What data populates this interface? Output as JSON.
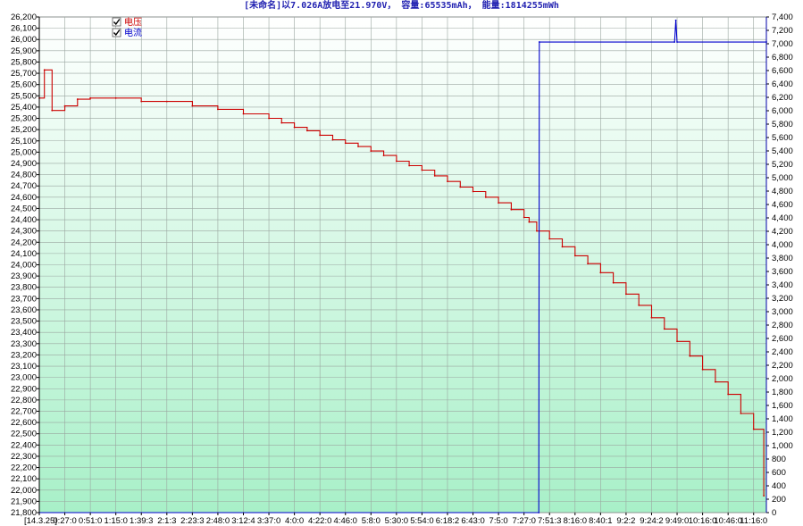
{
  "chart_data": {
    "type": "line",
    "title": "[未命名]以7.026A放电至21.970V， 容量:65535mAh， 能量:1814255mWh",
    "legend": [
      {
        "label": "电压",
        "checked": true,
        "color": "#cc0000"
      },
      {
        "label": "电流",
        "checked": true,
        "color": "#0000cc"
      }
    ],
    "legend_position": "top-left",
    "grid": true,
    "background_gradient": [
      "#ffffff",
      "#a8f0c8"
    ],
    "x_tick_labels": [
      "[14.3.25]",
      "0:27:0",
      "0:51:0",
      "1:15:0",
      "1:39:3",
      "2:1:3",
      "2:23:3",
      "2:48:0",
      "3:12:4",
      "3:37:0",
      "4:0:0",
      "4:22:0",
      "4:46:0",
      "5:8:0",
      "5:30:0",
      "5:54:0",
      "6:18:2",
      "6:43:0",
      "7:5:0",
      "7:27:0",
      "7:51:3",
      "8:16:0",
      "8:40:1",
      "9:2:2",
      "9:24:2",
      "9:49:0",
      "10:16:0",
      "10:46:0",
      "11:16:0"
    ],
    "y_left": {
      "ylim": [
        21800,
        26200
      ],
      "ticks": [
        "21,800",
        "21,900",
        "22,000",
        "22,100",
        "22,200",
        "22,300",
        "22,400",
        "22,500",
        "22,600",
        "22,700",
        "22,800",
        "22,900",
        "23,000",
        "23,100",
        "23,200",
        "23,300",
        "23,400",
        "23,500",
        "23,600",
        "23,700",
        "23,800",
        "23,900",
        "24,000",
        "24,100",
        "24,200",
        "24,300",
        "24,400",
        "24,500",
        "24,600",
        "24,700",
        "24,800",
        "24,900",
        "25,000",
        "25,100",
        "25,200",
        "25,300",
        "25,400",
        "25,500",
        "25,600",
        "25,700",
        "25,800",
        "25,900",
        "26,000",
        "26,100",
        "26,200"
      ]
    },
    "y_right": {
      "ylim": [
        0,
        7400
      ],
      "ticks": [
        "0",
        "200",
        "400",
        "600",
        "800",
        "1,000",
        "1,200",
        "1,400",
        "1,600",
        "1,800",
        "2,000",
        "2,200",
        "2,400",
        "2,600",
        "2,800",
        "3,000",
        "3,200",
        "3,400",
        "3,600",
        "3,800",
        "4,000",
        "4,200",
        "4,400",
        "4,600",
        "4,800",
        "5,000",
        "5,200",
        "5,400",
        "5,600",
        "5,800",
        "6,000",
        "6,200",
        "6,400",
        "6,600",
        "6,800",
        "7,000",
        "7,200",
        "7,400"
      ]
    },
    "series": [
      {
        "name": "电压",
        "axis": "left",
        "color": "#cc0000",
        "x": [
          0,
          0.2,
          0.5,
          1,
          1.5,
          2,
          3,
          4,
          5,
          6,
          7,
          8,
          9,
          9.5,
          10,
          10.5,
          11,
          11.5,
          12,
          12.5,
          13,
          13.5,
          14,
          14.5,
          15,
          15.5,
          16,
          16.5,
          17,
          17.5,
          18,
          18.5,
          19,
          19.2,
          19.5,
          20,
          20.5,
          21,
          21.5,
          22,
          22.5,
          23,
          23.5,
          24,
          24.5,
          25,
          25.5,
          26,
          26.5,
          27,
          27.5,
          28,
          28.4
        ],
        "y": [
          25480,
          25730,
          25370,
          25410,
          25470,
          25480,
          25480,
          25450,
          25450,
          25410,
          25380,
          25340,
          25300,
          25260,
          25220,
          25190,
          25150,
          25110,
          25080,
          25050,
          25010,
          24970,
          24920,
          24880,
          24840,
          24790,
          24740,
          24690,
          24650,
          24600,
          24550,
          24490,
          24420,
          24380,
          24300,
          24230,
          24160,
          24080,
          24010,
          23930,
          23840,
          23740,
          23640,
          23530,
          23430,
          23320,
          23190,
          23070,
          22960,
          22850,
          22680,
          22540,
          21950
        ]
      },
      {
        "name": "电流",
        "axis": "right",
        "color": "#0000cc",
        "x": [
          0,
          19.58,
          19.6,
          24.9,
          24.95,
          25,
          28.5
        ],
        "y": [
          0,
          0,
          7026,
          7026,
          7350,
          7026,
          7026
        ]
      }
    ]
  }
}
